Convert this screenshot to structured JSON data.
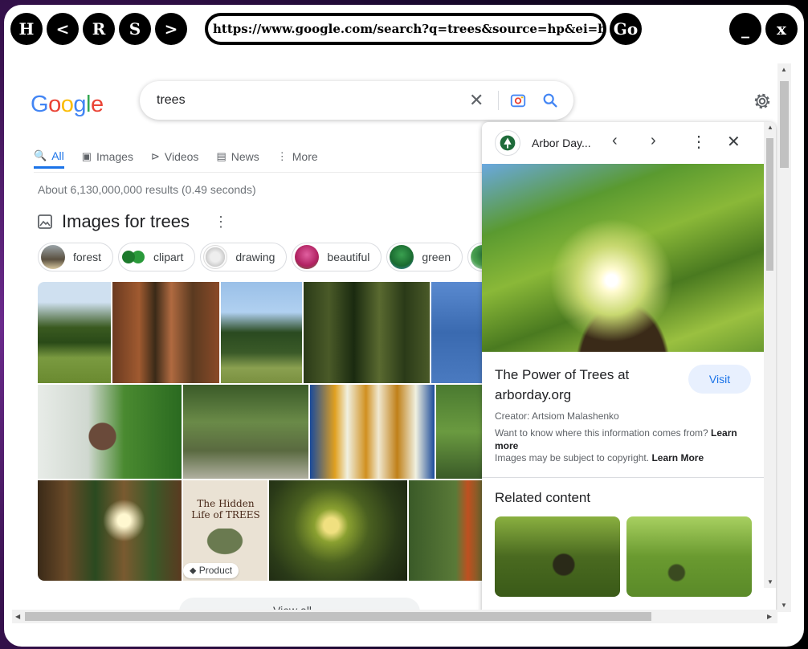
{
  "browser": {
    "buttons": {
      "home": "H",
      "back": "<",
      "reload": "R",
      "stop": "S",
      "forward": ">",
      "go": "Go",
      "minimize": "_",
      "close": "x"
    },
    "url": "https://www.google.com/search?q=trees&source=hp&ei=b_qlY"
  },
  "google": {
    "logo_letters": [
      "G",
      "o",
      "o",
      "g",
      "l",
      "e"
    ],
    "logo_colors": [
      "#4285F4",
      "#EA4335",
      "#FBBC05",
      "#4285F4",
      "#34A853",
      "#EA4335"
    ],
    "query": "trees",
    "tabs": [
      {
        "label": "All",
        "icon": "search-icon",
        "active": true
      },
      {
        "label": "Images",
        "icon": "image-icon"
      },
      {
        "label": "Videos",
        "icon": "play-icon"
      },
      {
        "label": "News",
        "icon": "news-icon"
      },
      {
        "label": "More",
        "icon": "more-vert-icon"
      }
    ],
    "stats": "About 6,130,000,000 results (0.49 seconds)",
    "images_heading": "Images for trees",
    "chips": [
      "forest",
      "clipart",
      "drawing",
      "beautiful",
      "green"
    ],
    "product_badge": "Product",
    "book_title": "The Hidden Life of TREES",
    "view_all": "View all"
  },
  "panel": {
    "source": "Arbor Day...",
    "title": "The Power of Trees at arborday.org",
    "visit": "Visit",
    "creator": "Creator: Artsiom Malashenko",
    "info_text": "Want to know where this information comes from?",
    "info_link": "Learn more",
    "copyright_text": "Images may be subject to copyright.",
    "copyright_link": "Learn More",
    "related": "Related content"
  },
  "colors": {
    "accent": "#1a73e8",
    "text": "#202124",
    "muted": "#5f6368"
  }
}
